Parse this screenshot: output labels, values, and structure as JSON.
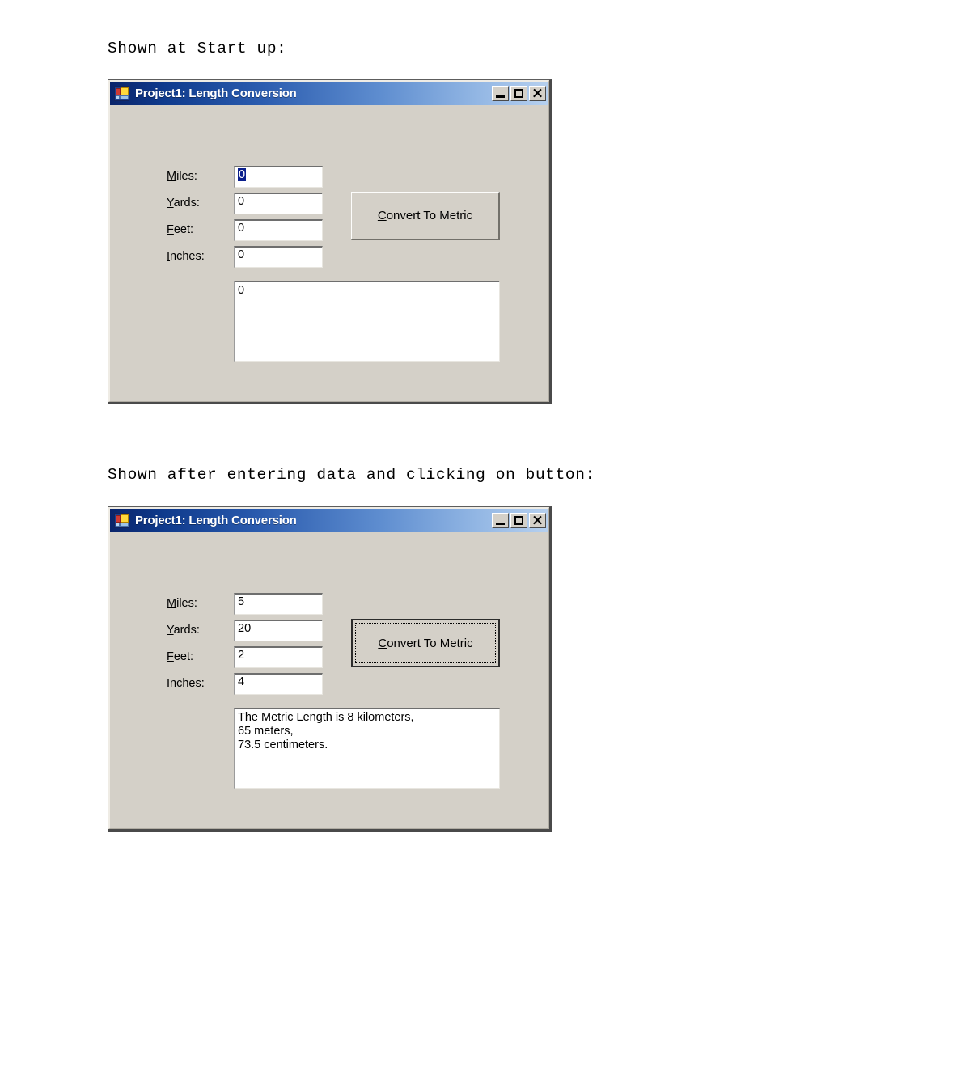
{
  "document": {
    "caption_startup": "Shown at Start up:",
    "caption_result": "Shown after entering data and clicking on button:"
  },
  "window_startup": {
    "title": "Project1: Length Conversion",
    "icon": "vb-form-icon",
    "titlebar_buttons": {
      "minimize": "minimize-icon",
      "maximize": "maximize-icon",
      "close": "close-icon"
    },
    "labels": {
      "miles": "Miles:",
      "yards": "Yards:",
      "feet": "Feet:",
      "inches": "Inches:"
    },
    "mnemonics": {
      "miles": "M",
      "yards": "Y",
      "feet": "F",
      "inches": "I"
    },
    "label_rest": {
      "miles": "iles:",
      "yards": "ards:",
      "feet": "eet:",
      "inches": "nches:"
    },
    "values": {
      "miles": "0",
      "yards": "0",
      "feet": "0",
      "inches": "0"
    },
    "button": {
      "mnemonic": "C",
      "rest": "onvert To Metric",
      "full_label": "Convert To Metric",
      "focused": false
    },
    "result": "0"
  },
  "window_result": {
    "title": "Project1: Length Conversion",
    "icon": "vb-form-icon",
    "titlebar_buttons": {
      "minimize": "minimize-icon",
      "maximize": "maximize-icon",
      "close": "close-icon"
    },
    "labels": {
      "miles": "Miles:",
      "yards": "Yards:",
      "feet": "Feet:",
      "inches": "Inches:"
    },
    "mnemonics": {
      "miles": "M",
      "yards": "Y",
      "feet": "F",
      "inches": "I"
    },
    "label_rest": {
      "miles": "iles:",
      "yards": "ards:",
      "feet": "eet:",
      "inches": "nches:"
    },
    "values": {
      "miles": "5",
      "yards": "20",
      "feet": "2",
      "inches": "4"
    },
    "button": {
      "mnemonic": "C",
      "rest": "onvert To Metric",
      "full_label": "Convert To Metric",
      "focused": true
    },
    "result": "The Metric Length is 8 kilometers,\n65 meters,\n73.5 centimeters."
  },
  "colors": {
    "form_face": "#d4d0c8",
    "titlebar_start": "#0a246a",
    "titlebar_end": "#b6d0ef",
    "selection": "#0a1e8c",
    "text": "#000000"
  }
}
